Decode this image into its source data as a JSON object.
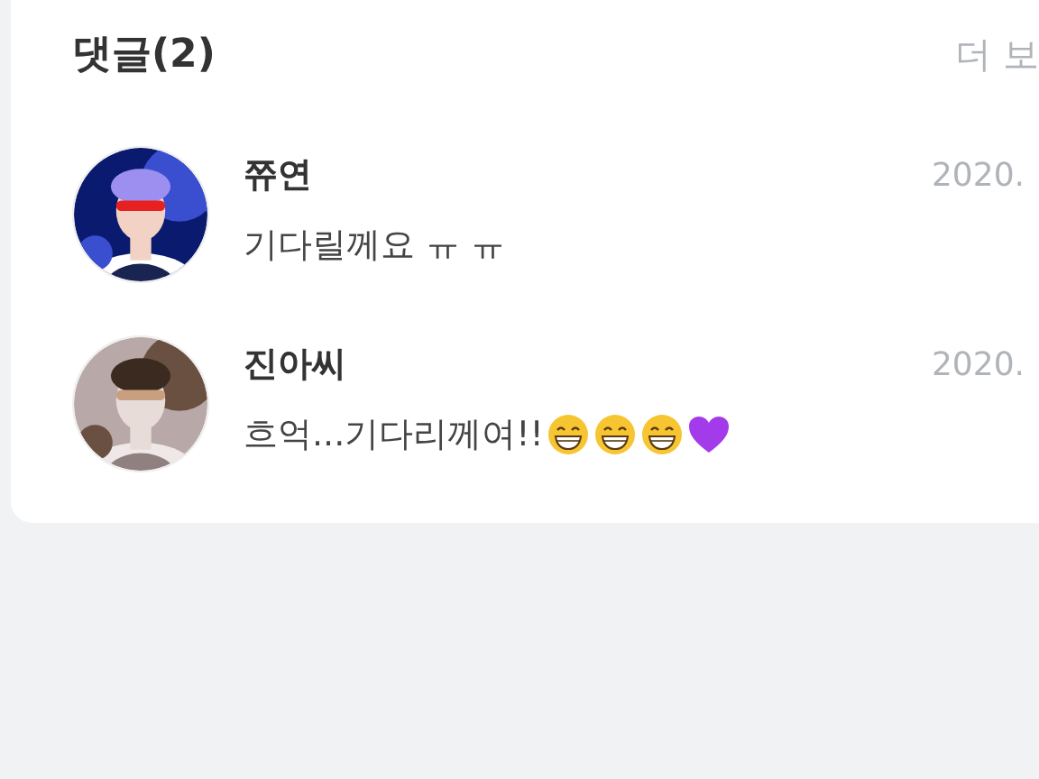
{
  "comments_section": {
    "title": "댓글(2)",
    "more_link": "더 보",
    "comments": [
      {
        "author": "쮸연",
        "text": "기다릴께요 ㅠ ㅠ",
        "date": "2020."
      },
      {
        "author": "진아씨",
        "text": "흐억...기다리께여!!",
        "date": "2020.",
        "emoji": [
          {
            "kind": "grin"
          },
          {
            "kind": "grin"
          },
          {
            "kind": "grin"
          },
          {
            "kind": "heart"
          }
        ]
      }
    ]
  }
}
